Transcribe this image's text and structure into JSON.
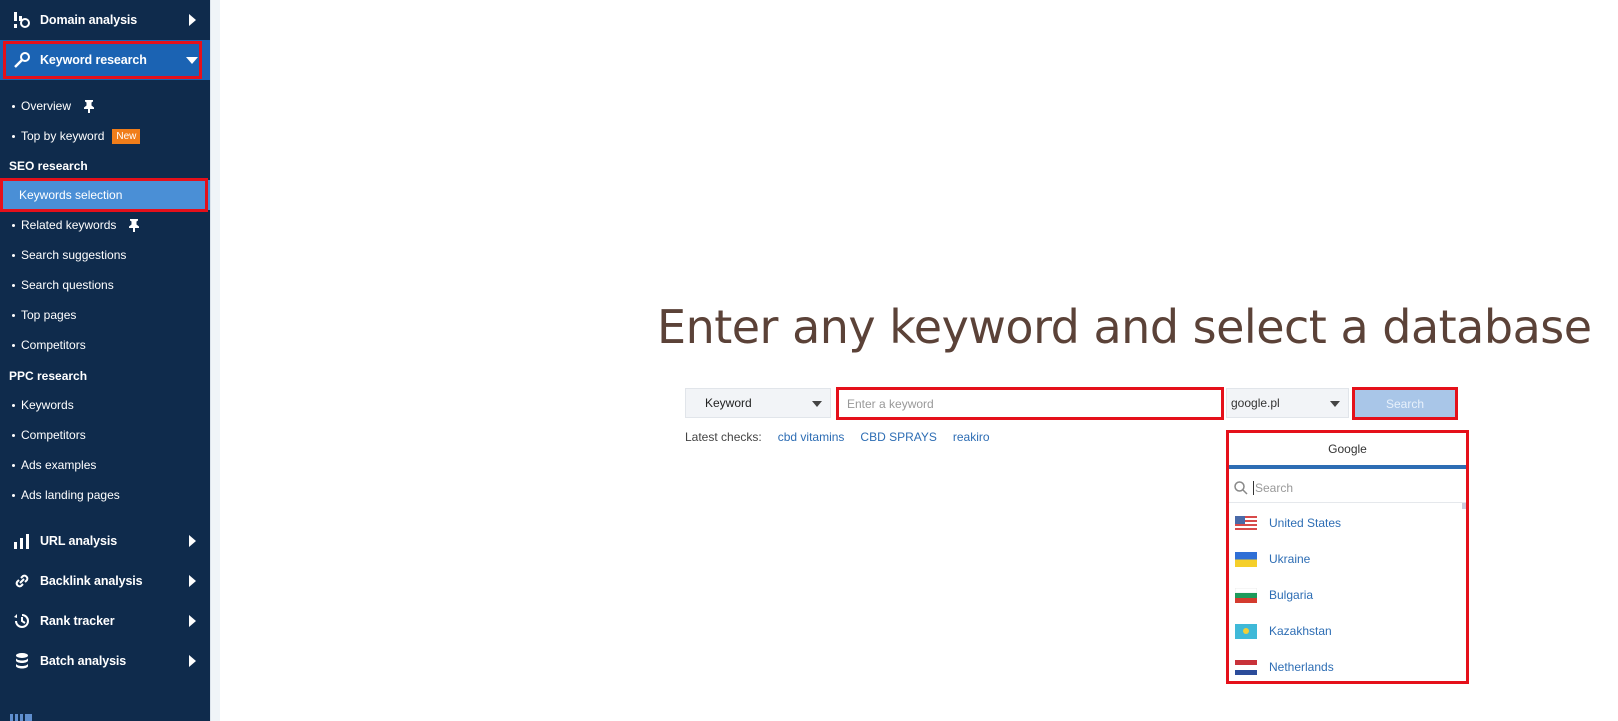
{
  "sidebar": {
    "domain_analysis": "Domain analysis",
    "keyword_research": "Keyword research",
    "overview": "Overview",
    "top_by_keyword": "Top by keyword",
    "new_badge": "New",
    "seo_group": "SEO research",
    "keywords_selection": "Keywords selection",
    "related_keywords": "Related keywords",
    "search_suggestions": "Search suggestions",
    "search_questions": "Search questions",
    "top_pages": "Top pages",
    "competitors_seo": "Competitors",
    "ppc_group": "PPC research",
    "keywords_ppc": "Keywords",
    "competitors_ppc": "Competitors",
    "ads_examples": "Ads examples",
    "ads_landing_pages": "Ads landing pages",
    "url_analysis": "URL analysis",
    "backlink_analysis": "Backlink analysis",
    "rank_tracker": "Rank tracker",
    "batch_analysis": "Batch analysis"
  },
  "main": {
    "title": "Enter any keyword and select a database",
    "type_select": "Keyword",
    "keyword_placeholder": "Enter a keyword",
    "database_select": "google.pl",
    "search_button": "Search",
    "latest_label": "Latest checks:",
    "latest_checks": [
      "cbd vitamins",
      "CBD SPRAYS",
      "reakiro"
    ]
  },
  "dropdown": {
    "tab": "Google",
    "search_placeholder": "Search",
    "countries": [
      {
        "name": "United States",
        "flag": "us-flag"
      },
      {
        "name": "Ukraine",
        "flag": "ua-flag"
      },
      {
        "name": "Bulgaria",
        "flag": "bg-flag"
      },
      {
        "name": "Kazakhstan",
        "flag": "kz-flag"
      },
      {
        "name": "Netherlands",
        "flag": "nl-flag"
      }
    ]
  },
  "colors": {
    "sidebar_bg": "#0f2b4c",
    "active_bg": "#1b63b3",
    "selected_bg": "#4a8fd6",
    "highlight": "#e5101a",
    "link": "#2d6db4",
    "badge": "#f07d1a"
  }
}
